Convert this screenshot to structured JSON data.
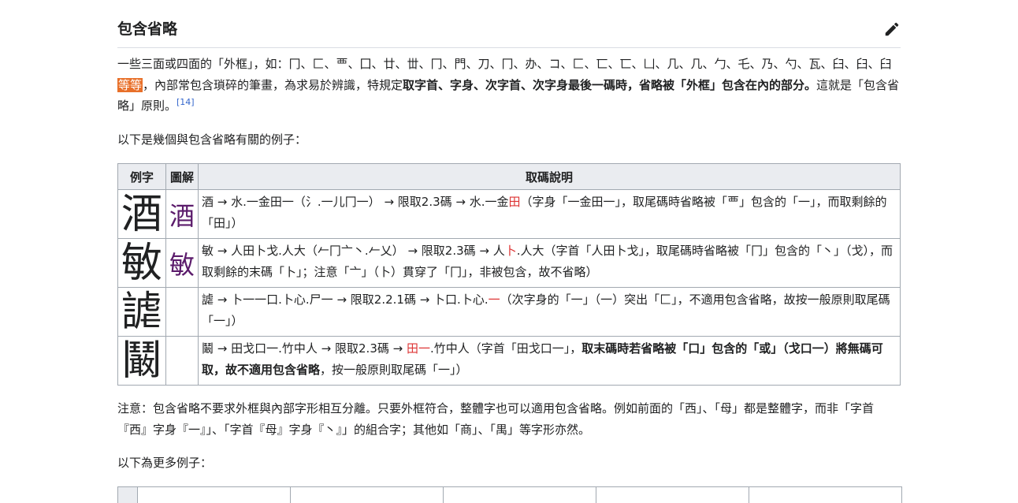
{
  "section": {
    "title": "包含省略",
    "edit_icon": "pencil-icon"
  },
  "para1": {
    "text_a": "一些三面或四面的「外框」，如：冂、匚、覀、囗、廿、丗、冂、門、刀、冂、办、コ、匚、匸、匸、凵、几、几、勹、乇、乃、勺、瓦、臼、臼、臼",
    "highlight": "等等",
    "text_b": "，內部常包含瑣碎的筆畫，為求易於辨識，特規定",
    "bold": "取字首、字身、次字首、次字身最後一碼時，省略被「外框」包含在內的部分。",
    "text_c": "這就是「包含省略」原則。",
    "ref": "[14]"
  },
  "para2": "以下是幾個與包含省略有關的例子：",
  "table": {
    "headers": [
      "例字",
      "圖解",
      "取碼說明"
    ],
    "rows": [
      {
        "char": "酒",
        "diagram": "酒",
        "a": "酒 → 水.一金田一（氵.一儿冂一） → 限取2.3碼 → 水.一金",
        "red": "田",
        "b": "（字身「一金田一」，取尾碼時省略被「覀」包含的「一」，而取剩餘的「田」）"
      },
      {
        "char": "敏",
        "diagram": "敏",
        "a": "敏 → 人田卜戈.人大（𠂉冂亠丶.𠂉乂） → 限取2.3碼 → 人",
        "red": "卜",
        "b": ".人大（字首「人田卜戈」，取尾碼時省略被「冂」包含的「丶」（戈），而取剩餘的末碼「卜」；注意「亠」（卜）貫穿了「冂」，非被包含，故不省略）"
      },
      {
        "char": "謔",
        "diagram": "",
        "a": "謔 → 卜一一口.卜心.尸一 → 限取2.2.1碼 → 卜口.卜心.",
        "red": "一",
        "b": "（次字身的「一」（一）突出「匚」，不適用包含省略，故按一般原則取尾碼「一」）"
      },
      {
        "char": "鬫",
        "diagram": "",
        "a": "鬫 → 田戈口一.竹中人 → 限取2.3碼 → ",
        "red": "田一",
        "b": ".竹中人（字首「田戈口一」，",
        "bold": "取末碼時若省略被「口」包含的「或」（戈口一）將無碼可取，故不適用包含省略",
        "c": "，按一般原則取尾碼「一」）"
      }
    ]
  },
  "para3": "注意：包含省略不要求外框與內部字形相互分離。只要外框符合，整體字也可以適用包含省略。例如前面的「西」、「母」都是整體字，而非「字首『西』字身『一』」、「字首『母』字身『丶』」的組合字；其他如「商」、「禺」等字形亦然。",
  "para4": "以下為更多例子："
}
